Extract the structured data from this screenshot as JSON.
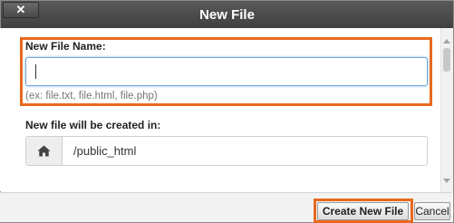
{
  "dialog": {
    "title": "New File",
    "close_label": "✕"
  },
  "form": {
    "name_label": "New File Name:",
    "name_value": "",
    "name_hint": "(ex: file.txt, file.html, file.php)",
    "location_label": "New file will be created in:",
    "location_value": "/public_html",
    "location_icon": "home-icon"
  },
  "actions": {
    "create_label": "Create New File",
    "cancel_label": "Cancel"
  },
  "colors": {
    "highlight": "#e8691d",
    "titlebar": "#4a4a4a"
  }
}
